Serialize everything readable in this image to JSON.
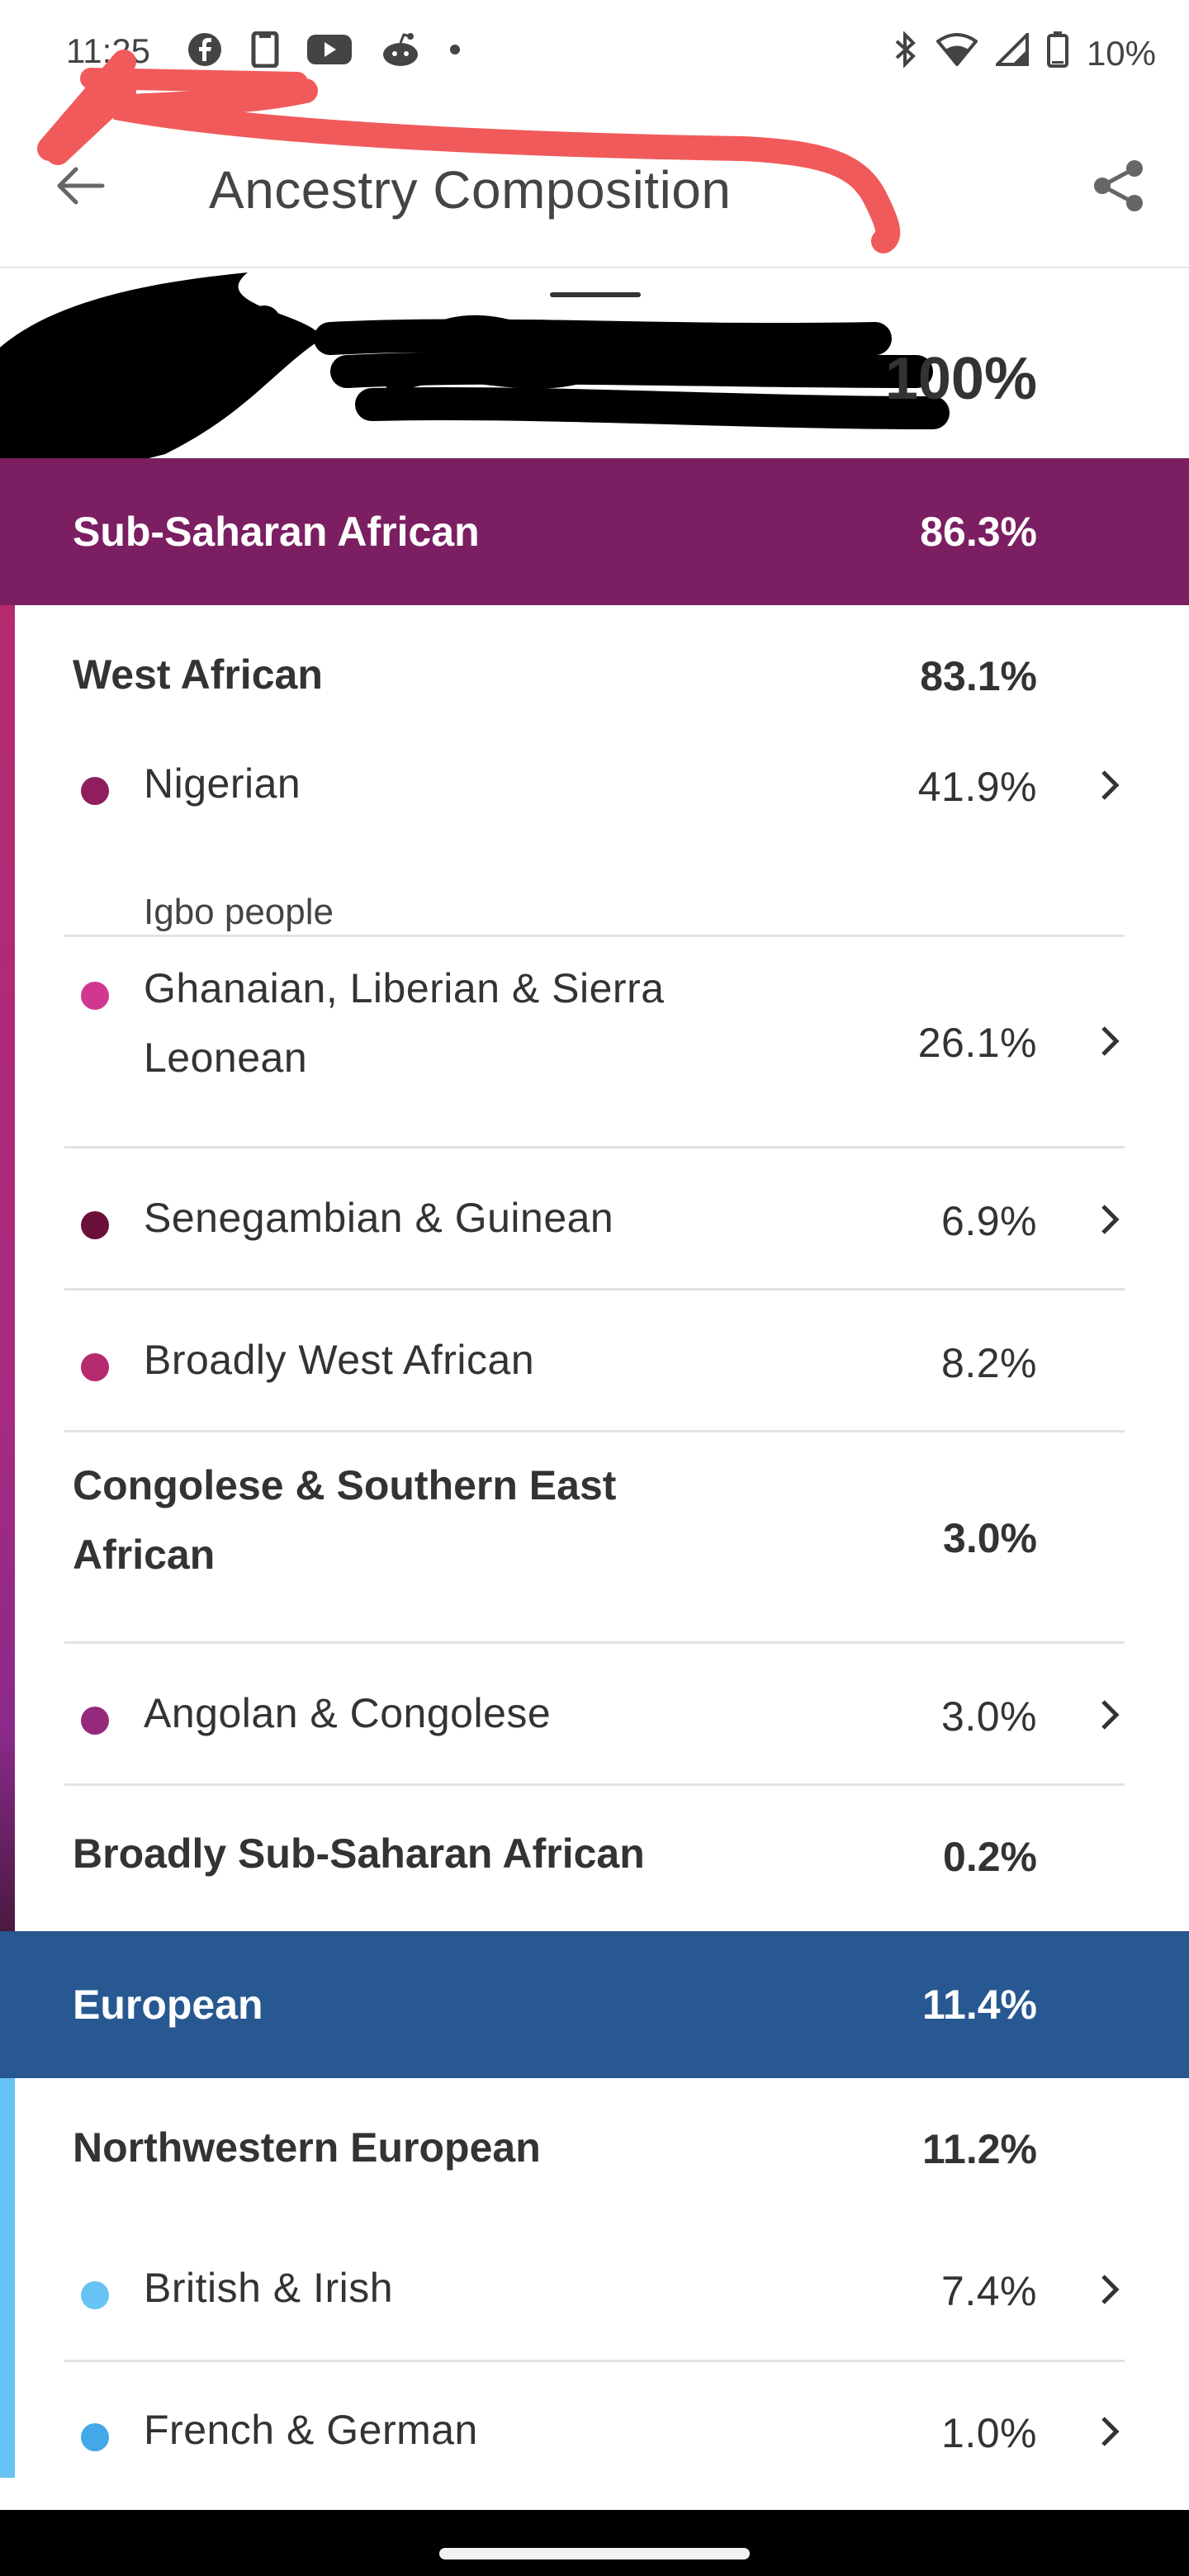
{
  "status_bar": {
    "time": "11:25",
    "battery": "10%",
    "left_icons": [
      "facebook-icon",
      "phone-icon",
      "youtube-icon",
      "reddit-icon",
      "dot-icon"
    ],
    "right_icons": [
      "bluetooth-icon",
      "wifi-icon",
      "signal-icon",
      "battery-icon"
    ]
  },
  "app_bar": {
    "title": "Ancestry Composition",
    "back_icon": "arrow-back-icon",
    "share_icon": "share-icon"
  },
  "summary": {
    "total": "100%"
  },
  "sections": {
    "sub_saharan": {
      "name": "Sub-Saharan African",
      "percent": "86.3%",
      "color": "#7b1f62",
      "west_african": {
        "name": "West African",
        "percent": "83.1%"
      },
      "nigerian": {
        "name": "Nigerian",
        "percent": "41.9%",
        "sublabel": "Igbo people",
        "color": "#8e1f5c"
      },
      "ghanaian": {
        "name": "Ghanaian, Liberian & Sierra Leonean",
        "percent": "26.1%",
        "color": "#d2378f"
      },
      "senegambian": {
        "name": "Senegambian & Guinean",
        "percent": "6.9%",
        "color": "#6b1038"
      },
      "broadly_west": {
        "name": "Broadly West African",
        "percent": "8.2%",
        "color": "#b52a6f"
      },
      "congolese_se": {
        "name": "Congolese & Southern East African",
        "percent": "3.0%"
      },
      "angolan": {
        "name": "Angolan & Congolese",
        "percent": "3.0%",
        "color": "#952a7d"
      },
      "broadly_ssa": {
        "name": "Broadly Sub-Saharan African",
        "percent": "0.2%"
      }
    },
    "european": {
      "name": "European",
      "percent": "11.4%",
      "color": "#275892",
      "northwestern": {
        "name": "Northwestern European",
        "percent": "11.2%"
      },
      "british": {
        "name": "British & Irish",
        "percent": "7.4%",
        "color": "#66c3f3"
      },
      "french": {
        "name": "French & German",
        "percent": "1.0%",
        "color": "#42a8e8"
      }
    }
  }
}
